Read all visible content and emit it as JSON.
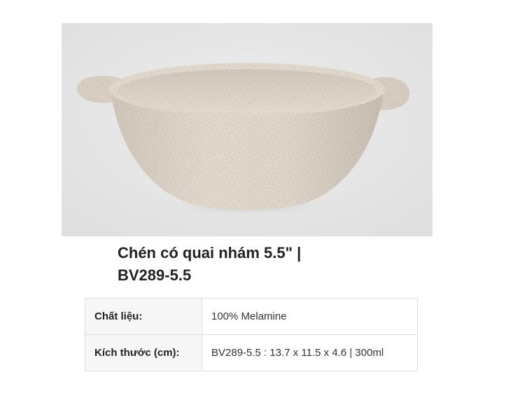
{
  "product": {
    "image_alt": "bowl-with-handles-photo",
    "title_line1": "Chén có quai nhám 5.5\" |",
    "title_line2": "BV289-5.5"
  },
  "specs": [
    {
      "label": "Chất liệu:",
      "value": "100% Melamine"
    },
    {
      "label": "Kích thước (cm):",
      "value": "BV289-5.5 : 13.7 x 11.5 x 4.6 | 300ml"
    }
  ],
  "colors": {
    "bowl": "#d9cec2",
    "background": "#e6e6e6",
    "table_label_bg": "#f7f7f7",
    "table_border": "#dddddd"
  }
}
